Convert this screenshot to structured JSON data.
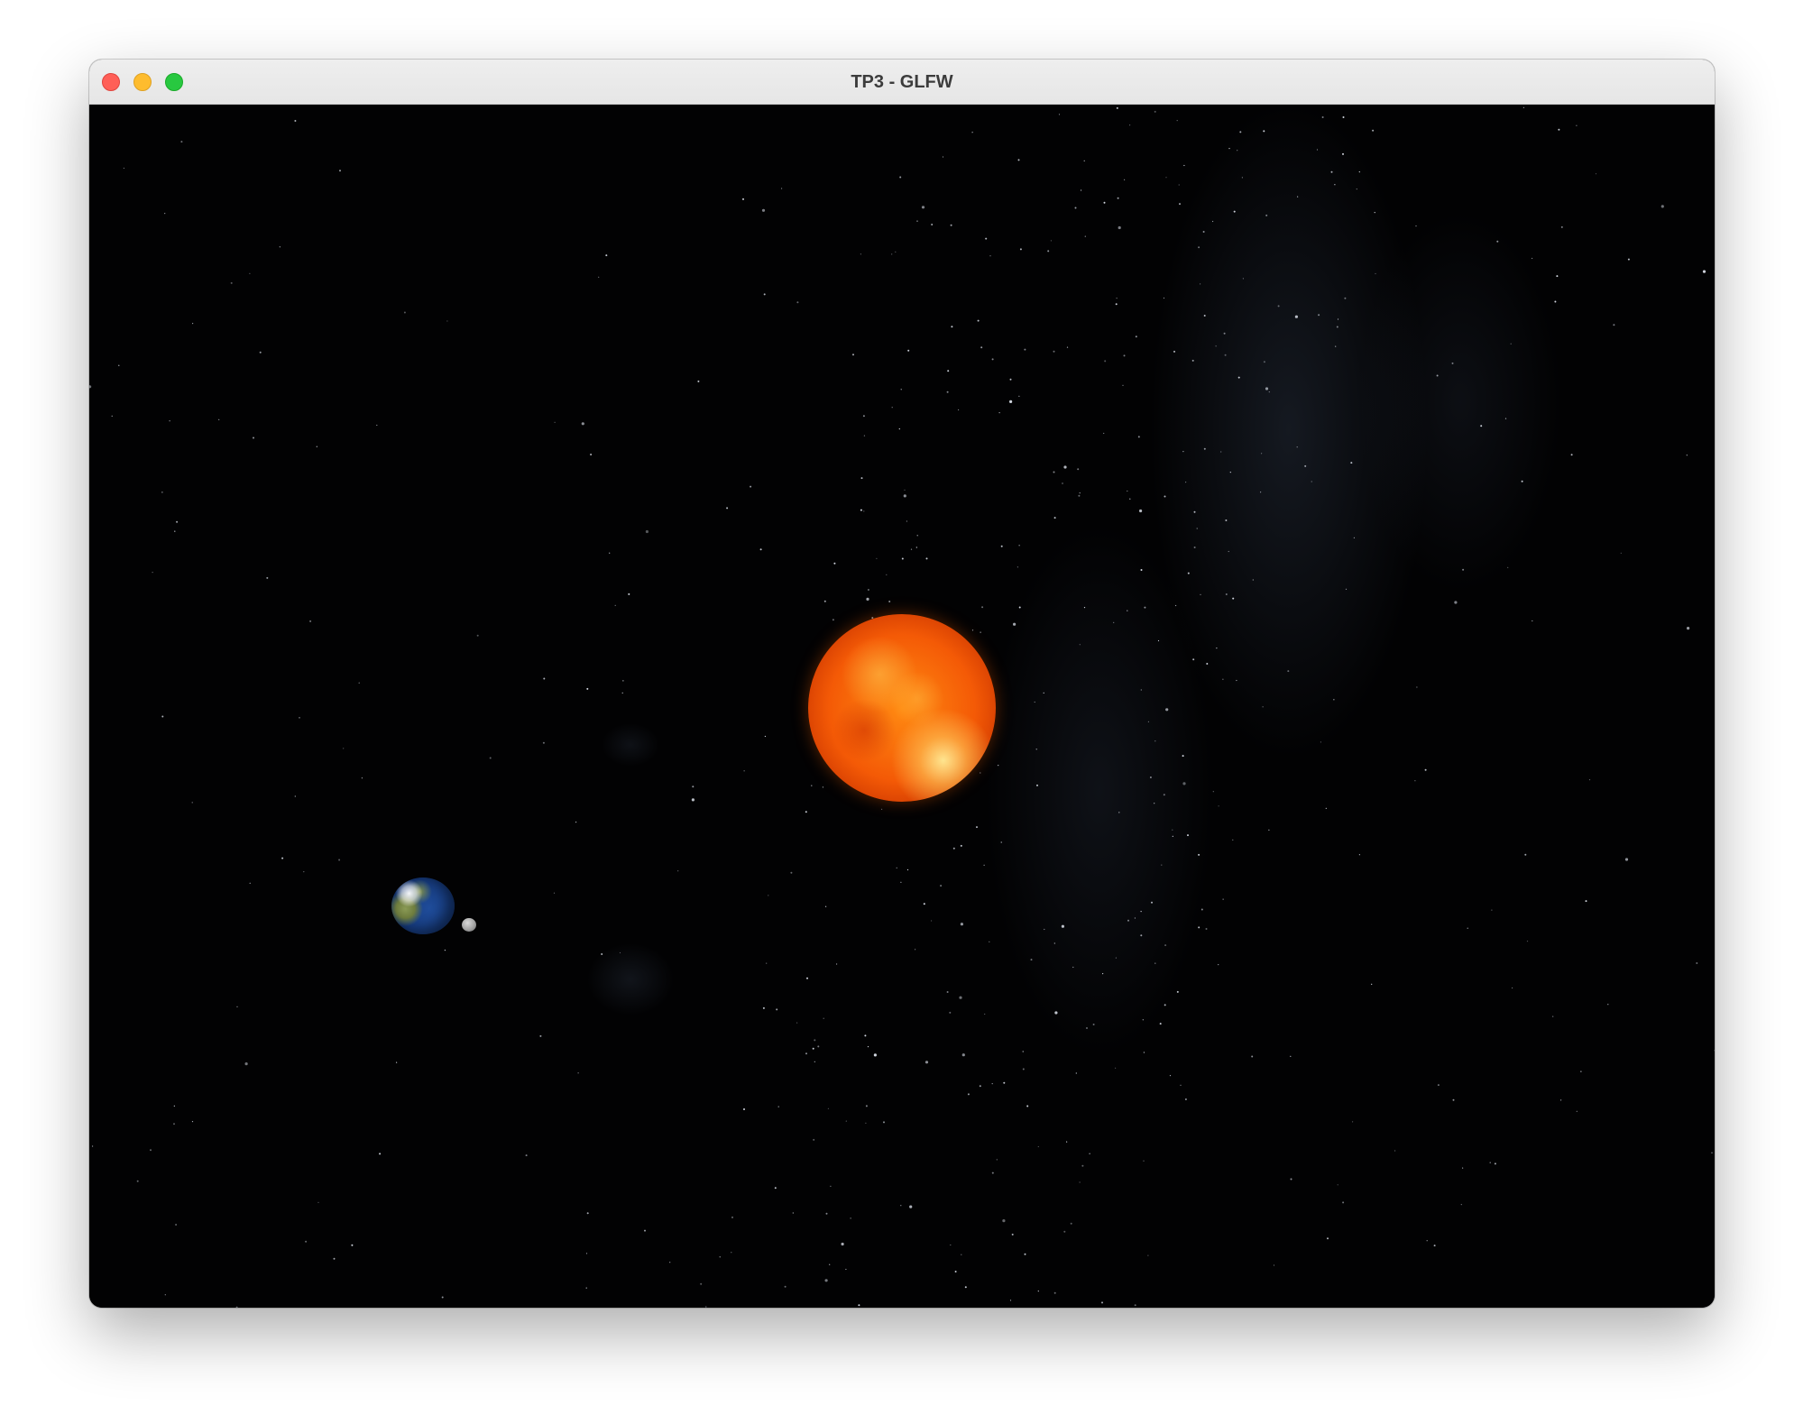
{
  "window": {
    "title": "TP3 - GLFW"
  },
  "scene": {
    "bodies": [
      {
        "name": "sun",
        "icon": "sun-sphere"
      },
      {
        "name": "earth",
        "icon": "earth-sphere"
      },
      {
        "name": "moon",
        "icon": "moon-sphere"
      }
    ],
    "background": "starfield"
  },
  "colors": {
    "close_button": "#ff5f57",
    "minimize_button": "#febc2e",
    "zoom_button": "#28c840",
    "sun": "#f45a06",
    "earth_ocean": "#163b7e",
    "space": "#020203"
  }
}
